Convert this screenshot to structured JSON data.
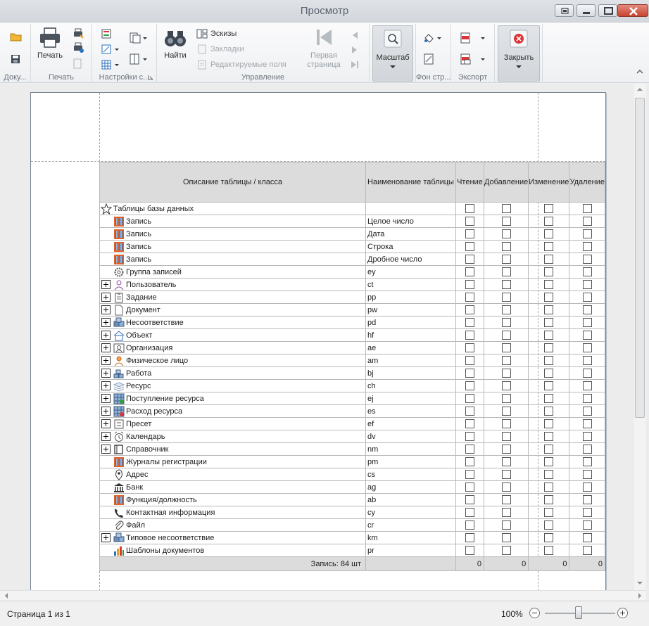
{
  "window": {
    "title": "Просмотр"
  },
  "ribbon": {
    "groups": {
      "document": {
        "label": "Доку..."
      },
      "print": {
        "label": "Печать",
        "print_button": "Печать"
      },
      "page_setup": {
        "label": "Настройки с..."
      },
      "navigation": {
        "label": "Управление",
        "find": "Найти",
        "thumbnails": "Эскизы",
        "bookmarks": "Закладки",
        "editable_fields": "Редактируемые поля",
        "first_page_line1": "Первая",
        "first_page_line2": "страница"
      },
      "zoom": {
        "label": "Масштаб"
      },
      "background": {
        "label": "Фон стр..."
      },
      "export": {
        "label": "Экспорт"
      },
      "close": {
        "label": "Закрыть"
      }
    }
  },
  "table": {
    "headers": [
      "Описание таблицы / класса",
      "Наименование таблицы",
      "Чтение",
      "Добавление",
      "Изменение",
      "Удаление"
    ],
    "rows": [
      {
        "name": "Таблицы базы данных",
        "code": "",
        "icon": "star-icon",
        "expand": false,
        "indent": 0
      },
      {
        "name": "Запись",
        "code": "Целое число",
        "icon": "record-icon",
        "expand": false,
        "indent": 1
      },
      {
        "name": "Запись",
        "code": "Дата",
        "icon": "record-icon",
        "expand": false,
        "indent": 1
      },
      {
        "name": "Запись",
        "code": "Строка",
        "icon": "record-icon",
        "expand": false,
        "indent": 1
      },
      {
        "name": "Запись",
        "code": "Дробное число",
        "icon": "record-icon",
        "expand": false,
        "indent": 1
      },
      {
        "name": "Группа записей",
        "code": "ey",
        "icon": "gear-icon",
        "expand": false,
        "indent": 1
      },
      {
        "name": "Пользователь",
        "code": "ct",
        "icon": "user-icon",
        "expand": true,
        "indent": 1
      },
      {
        "name": "Задание",
        "code": "pp",
        "icon": "clipboard-icon",
        "expand": true,
        "indent": 1
      },
      {
        "name": "Документ",
        "code": "pw",
        "icon": "document-icon",
        "expand": true,
        "indent": 1
      },
      {
        "name": "Несоответствие",
        "code": "pd",
        "icon": "cubes-icon",
        "expand": true,
        "indent": 1
      },
      {
        "name": "Объект",
        "code": "hf",
        "icon": "house-icon",
        "expand": true,
        "indent": 1
      },
      {
        "name": "Организация",
        "code": "ae",
        "icon": "contact-card-icon",
        "expand": true,
        "indent": 1
      },
      {
        "name": "Физическое лицо",
        "code": "am",
        "icon": "person-icon",
        "expand": true,
        "indent": 1
      },
      {
        "name": "Работа",
        "code": "bj",
        "icon": "bricks-icon",
        "expand": true,
        "indent": 1
      },
      {
        "name": "Ресурс",
        "code": "ch",
        "icon": "layers-icon",
        "expand": true,
        "indent": 1
      },
      {
        "name": "Поступление ресурса",
        "code": "ej",
        "icon": "inbound-grid-icon",
        "expand": true,
        "indent": 1
      },
      {
        "name": "Расход ресурса",
        "code": "es",
        "icon": "outbound-grid-icon",
        "expand": true,
        "indent": 1
      },
      {
        "name": "Пресет",
        "code": "ef",
        "icon": "preset-icon",
        "expand": true,
        "indent": 1
      },
      {
        "name": "Календарь",
        "code": "dv",
        "icon": "alarm-clock-icon",
        "expand": true,
        "indent": 1
      },
      {
        "name": "Справочник",
        "code": "nm",
        "icon": "book-icon",
        "expand": true,
        "indent": 1
      },
      {
        "name": "Журналы регистрации",
        "code": "pm",
        "icon": "record-icon",
        "expand": false,
        "indent": 1
      },
      {
        "name": "Адрес",
        "code": "cs",
        "icon": "map-pin-icon",
        "expand": false,
        "indent": 1
      },
      {
        "name": "Банк",
        "code": "ag",
        "icon": "bank-icon",
        "expand": false,
        "indent": 1
      },
      {
        "name": "Функция/должность",
        "code": "ab",
        "icon": "record-icon",
        "expand": false,
        "indent": 1
      },
      {
        "name": "Контактная информация",
        "code": "cy",
        "icon": "phone-icon",
        "expand": false,
        "indent": 1
      },
      {
        "name": "Файл",
        "code": "cr",
        "icon": "paperclip-icon",
        "expand": false,
        "indent": 1
      },
      {
        "name": "Типовое несоответствие",
        "code": "km",
        "icon": "cubes-icon",
        "expand": true,
        "indent": 1
      },
      {
        "name": "Шаблоны документов",
        "code": "pr",
        "icon": "bar-chart-icon",
        "expand": false,
        "indent": 1
      }
    ],
    "footer": {
      "summary": "Запись: 84 шт",
      "read": "0",
      "add": "0",
      "edit": "0",
      "delete": "0"
    }
  },
  "status": {
    "page": "Страница 1 из 1",
    "zoom_text": "100%",
    "zoom_level": 0.48
  },
  "colors": {
    "accent": "#2b6fbd",
    "close_red": "#d9343a",
    "record_orange": "#e0622a"
  }
}
